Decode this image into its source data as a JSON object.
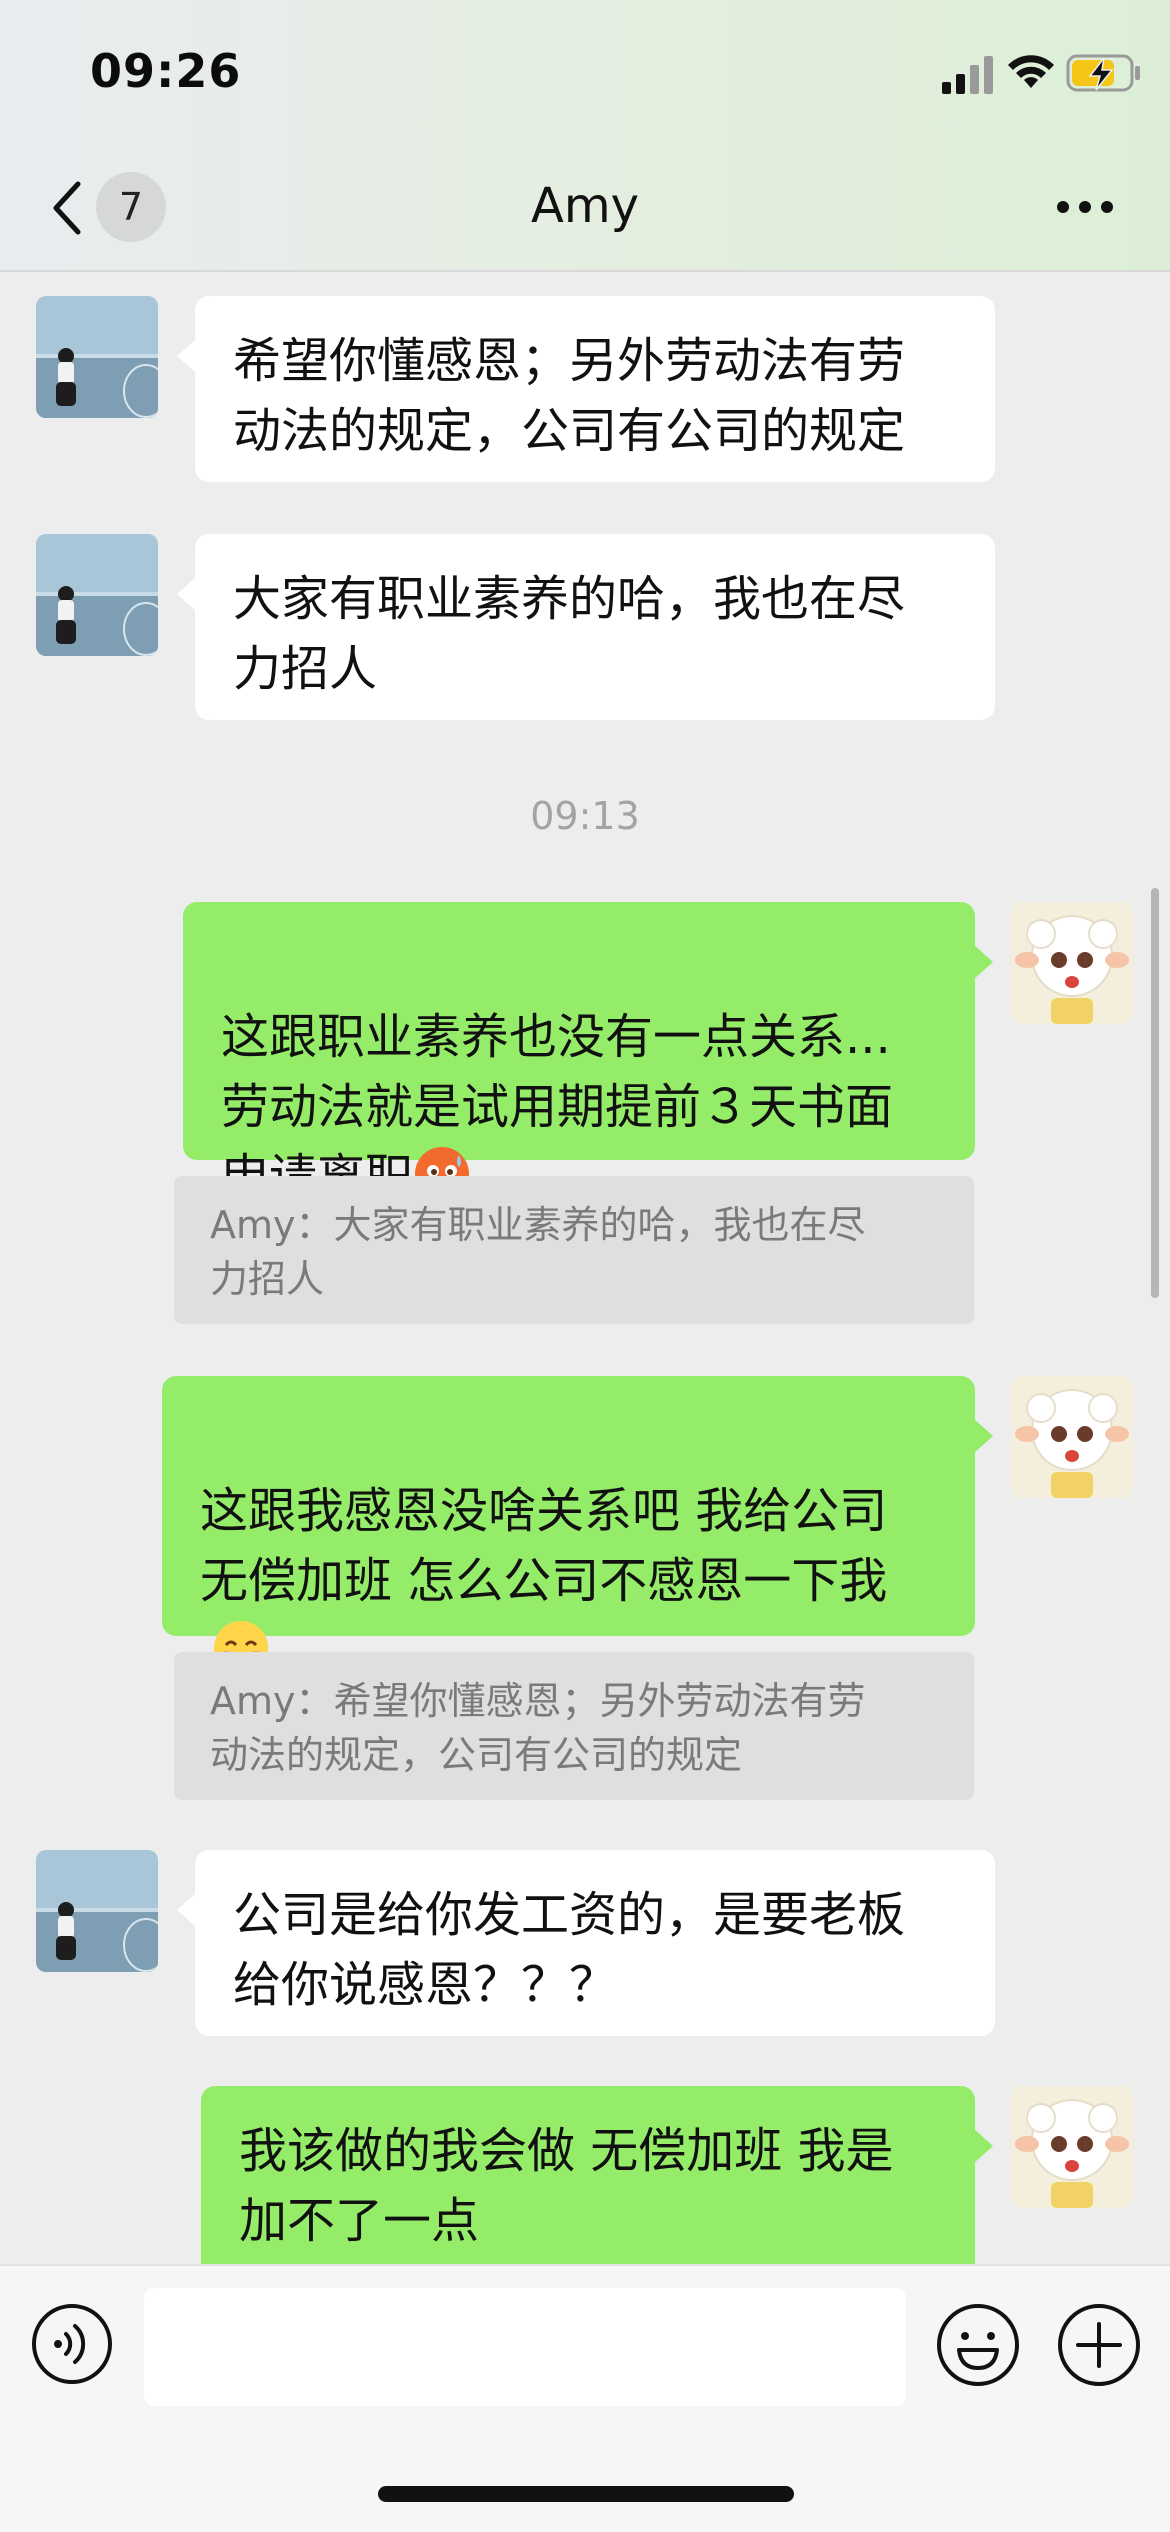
{
  "status_bar": {
    "time": "09:26"
  },
  "nav": {
    "unread_count": "7",
    "title": "Amy"
  },
  "messages": [
    {
      "side": "in",
      "text": "希望你懂感恩；另外劳动法有劳\n动法的规定，公司有公司的规定"
    },
    {
      "side": "in",
      "text": "大家有职业素养的哈，我也在尽\n力招人"
    },
    {
      "type": "timestamp",
      "text": "09:13"
    },
    {
      "side": "out",
      "text": "这跟职业素养也没有一点关系...\n劳动法就是试用期提前３天书面\n申请离职",
      "emoji": "anxious-sweat-face-emoji"
    },
    {
      "type": "quote",
      "text": "Amy：大家有职业素养的哈，我也在尽\n力招人"
    },
    {
      "side": "out",
      "text": "这跟我感恩没啥关系吧 我给公司\n无偿加班 怎么公司不感恩一下我",
      "emoji": "smiling-face-emoji"
    },
    {
      "type": "quote",
      "text": "Amy：希望你懂感恩；另外劳动法有劳\n动法的规定，公司有公司的规定"
    },
    {
      "side": "in",
      "text": "公司是给你发工资的，是要老板\n给你说感恩？？？"
    },
    {
      "side": "out",
      "text": "我该做的我会做 无偿加班 我是\n加不了一点"
    }
  ],
  "input": {
    "placeholder": ""
  },
  "colors": {
    "incoming_bubble": "#ffffff",
    "outgoing_bubble": "#95ec69",
    "chat_background": "#ededed",
    "quote_background": "#dfdfdf"
  },
  "icons": {
    "back": "chevron-left-icon",
    "more": "more-dots-icon",
    "voice": "voice-icon",
    "emoji": "emoji-icon",
    "plus": "plus-icon"
  }
}
